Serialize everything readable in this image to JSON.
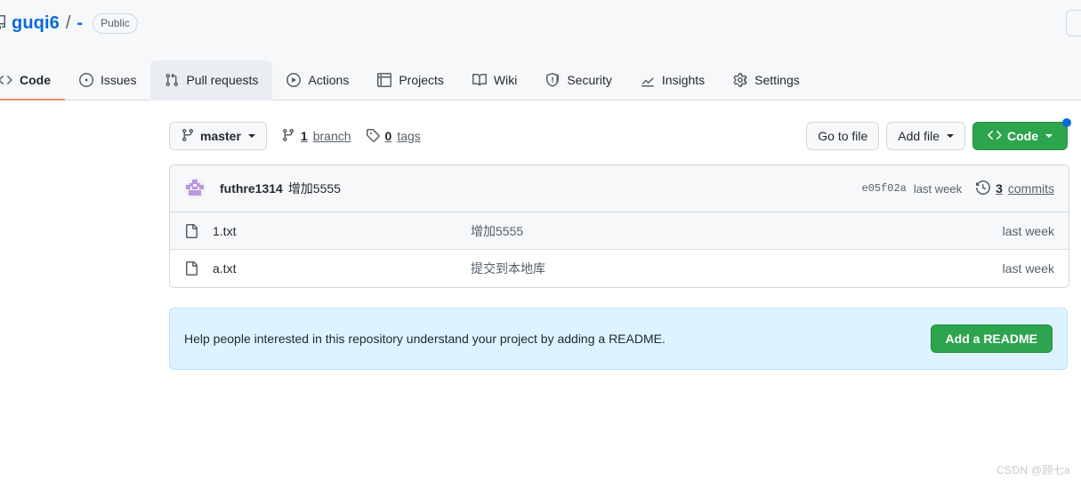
{
  "repo": {
    "icon": "repo-icon",
    "owner": "guqi6",
    "separator": "/",
    "name": "-",
    "visibility": "Public"
  },
  "nav": {
    "items": [
      {
        "label": "Code",
        "icon": "code-icon",
        "selected": true
      },
      {
        "label": "Issues",
        "icon": "issue-opened-icon",
        "selected": false
      },
      {
        "label": "Pull requests",
        "icon": "git-pull-request-icon",
        "selected": false
      },
      {
        "label": "Actions",
        "icon": "play-icon",
        "selected": false
      },
      {
        "label": "Projects",
        "icon": "table-icon",
        "selected": false
      },
      {
        "label": "Wiki",
        "icon": "book-icon",
        "selected": false
      },
      {
        "label": "Security",
        "icon": "shield-icon",
        "selected": false
      },
      {
        "label": "Insights",
        "icon": "graph-icon",
        "selected": false
      },
      {
        "label": "Settings",
        "icon": "gear-icon",
        "selected": false
      }
    ]
  },
  "toolbar": {
    "branch": {
      "icon": "git-branch-icon",
      "label": "master"
    },
    "branch_count": {
      "icon": "git-branch-icon",
      "count": "1",
      "label": "branch"
    },
    "tag_count": {
      "icon": "tag-icon",
      "count": "0",
      "label": "tags"
    },
    "go_to_file": "Go to file",
    "add_file": "Add file",
    "code": "Code",
    "code_icon": "code-angle-brackets-icon"
  },
  "commit": {
    "author": "futhre1314",
    "message": "增加5555",
    "sha": "e05f02a",
    "time": "last week",
    "commits_count": "3",
    "commits_label": "commits",
    "commits_icon": "history-icon"
  },
  "files": [
    {
      "icon": "file-icon",
      "name": "1.txt",
      "commit_message": "增加5555",
      "time": "last week",
      "hovered": true
    },
    {
      "icon": "file-icon",
      "name": "a.txt",
      "commit_message": "提交到本地库",
      "time": "last week",
      "hovered": false
    }
  ],
  "readme_banner": {
    "text": "Help people interested in this repository understand your project by adding a README.",
    "button": "Add a README"
  },
  "watermark": "CSDN @顾七a",
  "colors": {
    "accent_blue": "#0969da",
    "active_tab_underline": "#fd8c73",
    "green_button": "#2da44e",
    "banner_bg": "#ddf4ff",
    "banner_border": "#b6e3ff",
    "header_bg": "#f6f8fa",
    "border": "#d0d7de",
    "muted_text": "#57606a",
    "badge_dot": "#0969da",
    "avatar_purple": "#bb96e0"
  }
}
